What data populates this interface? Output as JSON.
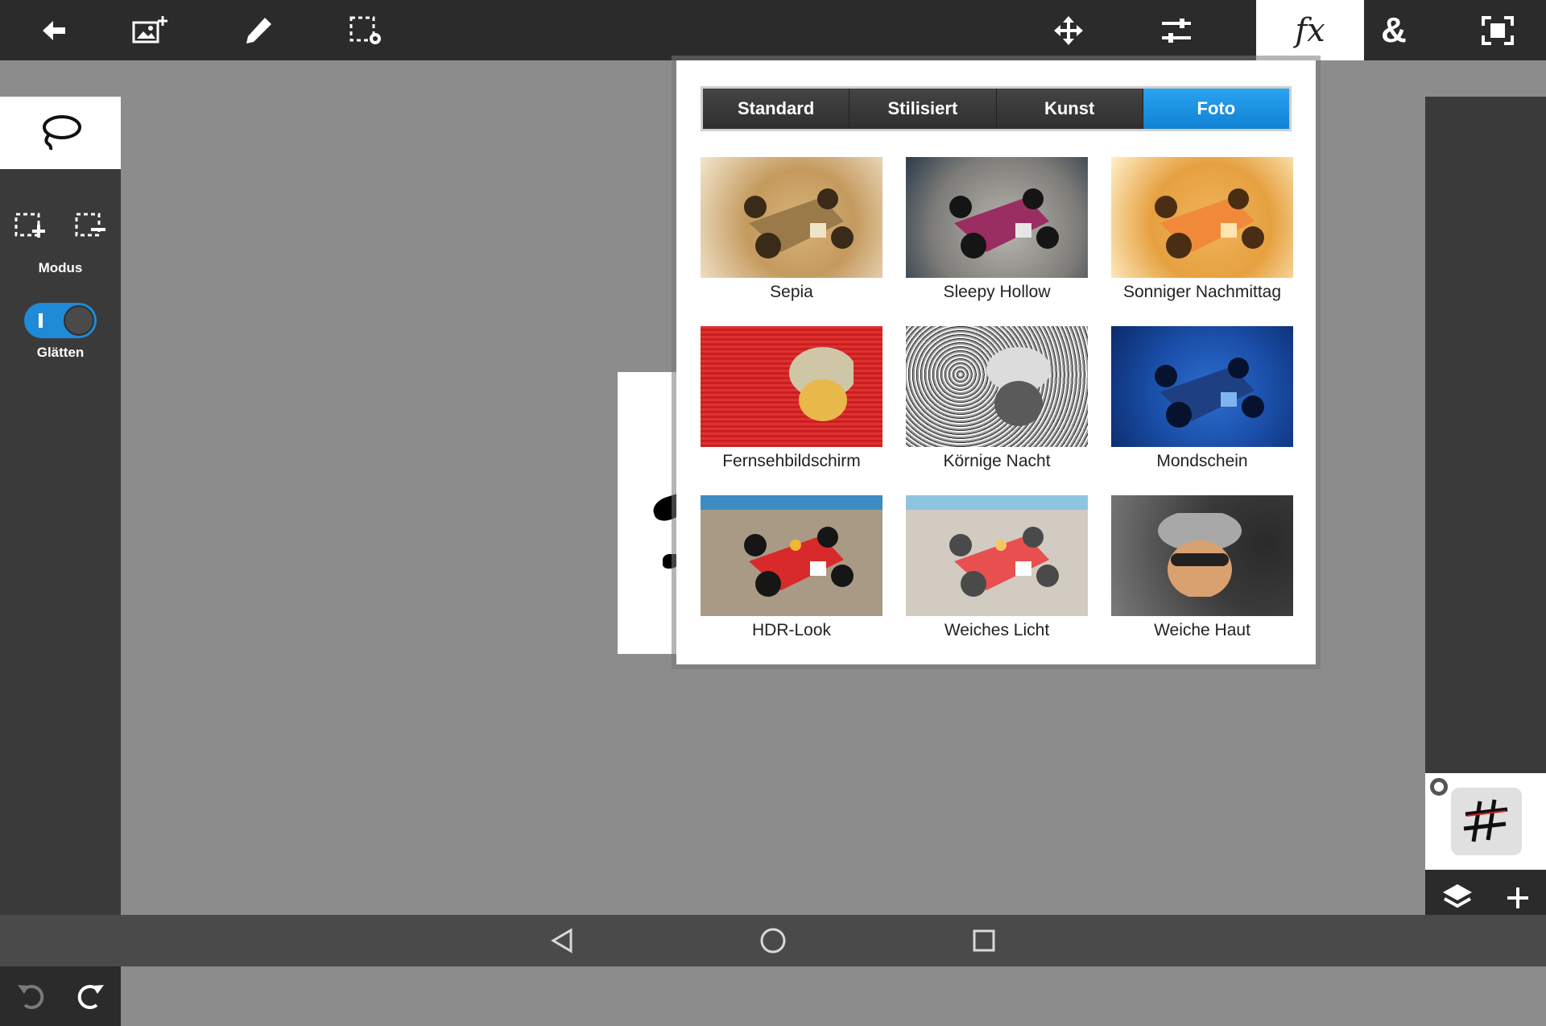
{
  "toolbar": {
    "icons": [
      "back-arrow-icon",
      "add-image-icon",
      "brush-icon",
      "selection-settings-icon",
      "move-icon",
      "adjustments-icon",
      "fx-icon",
      "ampersand-icon",
      "fit-screen-icon"
    ],
    "fx_label": "fx",
    "text_label": "&"
  },
  "left_panel": {
    "mode_label": "Modus",
    "smooth_label": "Glätten",
    "smooth_enabled": true,
    "icons": [
      "lasso-icon",
      "add-selection-icon",
      "subtract-selection-icon",
      "undo-icon",
      "redo-icon"
    ]
  },
  "fx_panel": {
    "tabs": [
      "Standard",
      "Stilisiert",
      "Kunst",
      "Foto"
    ],
    "active_tab": "Foto",
    "effects": [
      {
        "name": "Sepia"
      },
      {
        "name": "Sleepy Hollow"
      },
      {
        "name": "Sonniger Nachmittag"
      },
      {
        "name": "Fernsehbildschirm"
      },
      {
        "name": "Körnige Nacht"
      },
      {
        "name": "Mondschein"
      },
      {
        "name": "HDR-Look"
      },
      {
        "name": "Weiches Licht"
      },
      {
        "name": "Weiche Haut"
      }
    ],
    "accent_color": "#1a8fe0"
  },
  "right_panel": {
    "icons": [
      "layers-icon",
      "add-layer-icon"
    ]
  },
  "navbar": {
    "icons": [
      "nav-back-icon",
      "nav-home-icon",
      "nav-recents-icon"
    ]
  }
}
